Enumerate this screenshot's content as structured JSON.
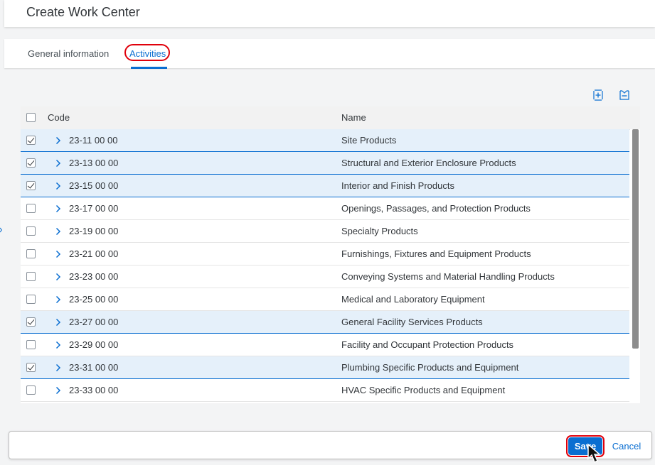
{
  "header": {
    "title": "Create Work Center"
  },
  "tabs": [
    {
      "label": "General information",
      "selected": false
    },
    {
      "label": "Activities",
      "selected": true
    }
  ],
  "toolbar": {
    "expand_icon": "expand-all-icon",
    "collapse_icon": "collapse-all-icon"
  },
  "table": {
    "columns": {
      "code": "Code",
      "name": "Name"
    },
    "rows": [
      {
        "code": "23-11 00 00",
        "name": "Site Products",
        "checked": true
      },
      {
        "code": "23-13 00 00",
        "name": "Structural and Exterior Enclosure Products",
        "checked": true
      },
      {
        "code": "23-15 00 00",
        "name": "Interior and Finish Products",
        "checked": true
      },
      {
        "code": "23-17 00 00",
        "name": "Openings, Passages, and Protection Products",
        "checked": false
      },
      {
        "code": "23-19 00 00",
        "name": "Specialty Products",
        "checked": false
      },
      {
        "code": "23-21 00 00",
        "name": "Furnishings, Fixtures and Equipment Products",
        "checked": false
      },
      {
        "code": "23-23 00 00",
        "name": "Conveying Systems and Material Handling Products",
        "checked": false
      },
      {
        "code": "23-25 00 00",
        "name": "Medical and Laboratory Equipment",
        "checked": false
      },
      {
        "code": "23-27 00 00",
        "name": "General Facility Services Products",
        "checked": true
      },
      {
        "code": "23-29 00 00",
        "name": "Facility and Occupant Protection Products",
        "checked": false
      },
      {
        "code": "23-31 00 00",
        "name": "Plumbing Specific Products and Equipment",
        "checked": true
      },
      {
        "code": "23-33 00 00",
        "name": "HVAC Specific Products and Equipment",
        "checked": false
      }
    ]
  },
  "footer": {
    "save_label": "Save",
    "cancel_label": "Cancel"
  },
  "colors": {
    "accent": "#0a6ed1",
    "selected_row": "#e5f0fa",
    "highlight": "#e0000b"
  }
}
